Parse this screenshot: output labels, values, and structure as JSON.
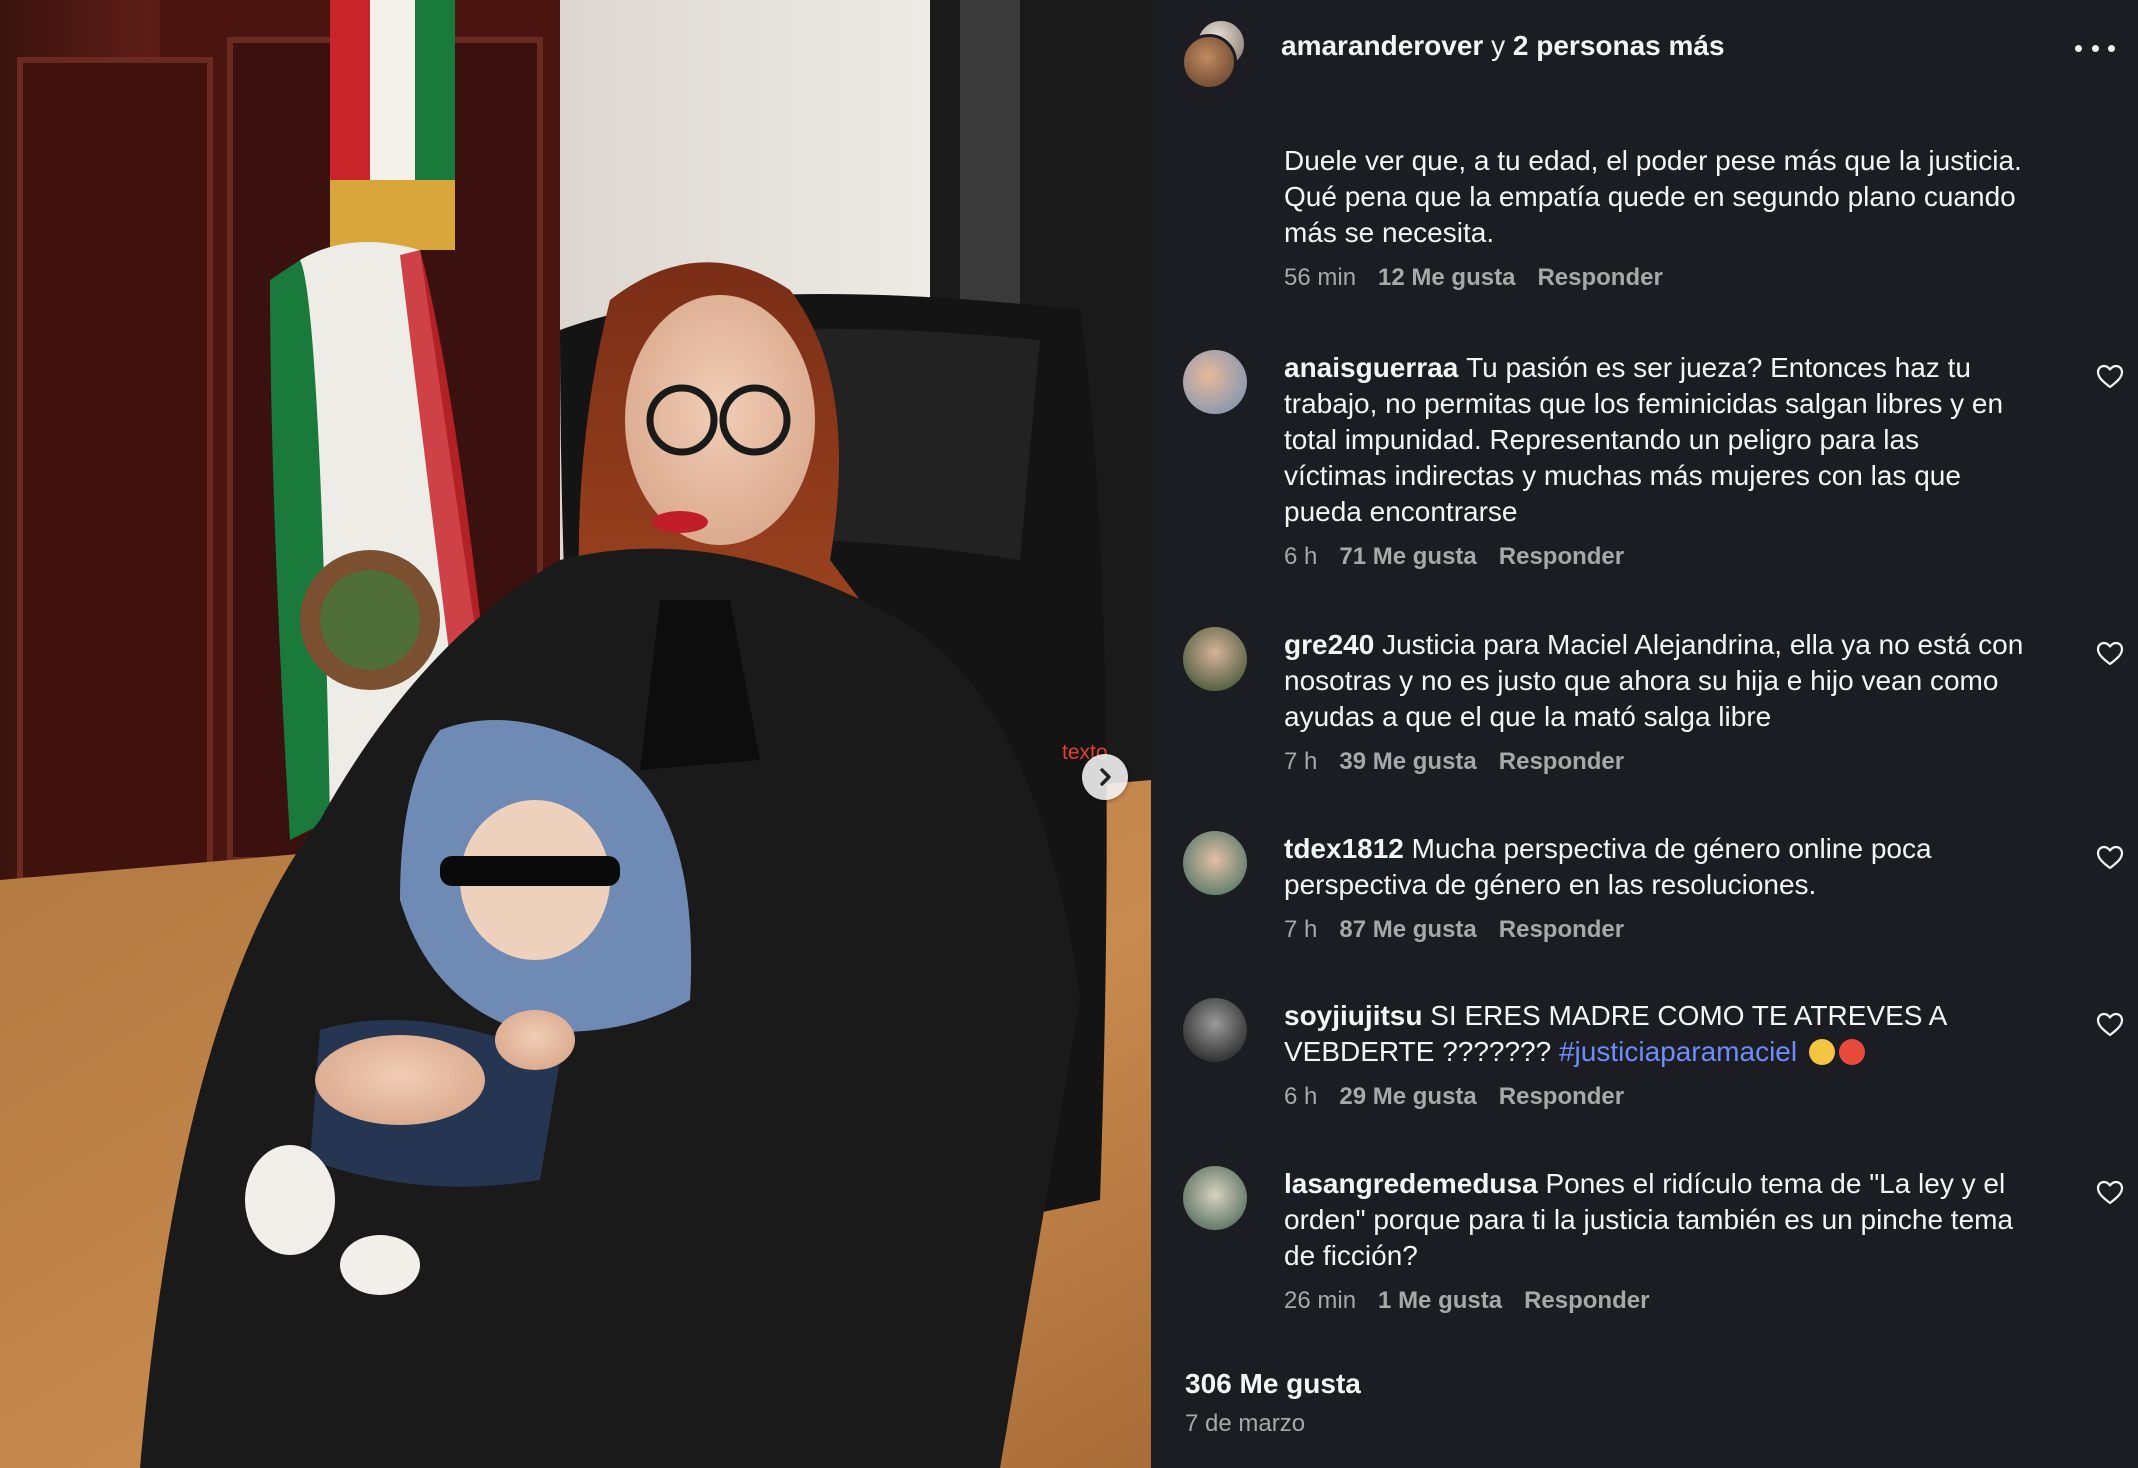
{
  "photo": {
    "caption_overlay": "texto",
    "next_icon": "chevron-right-icon"
  },
  "header": {
    "username": "amaranderover",
    "connector": "y",
    "others": "2 personas más",
    "more_icon": "more-horizontal-icon"
  },
  "comments": [
    {
      "username": "",
      "text": "Duele ver que, a tu edad, el poder pese más que la justicia. Qué pena que la empatía quede en segundo plano cuando más se necesita.",
      "time": "56 min",
      "likes": "12 Me gusta",
      "reply": "Responder"
    },
    {
      "username": "anaisguerraa",
      "text": "Tu pasión es ser jueza? Entonces haz tu trabajo, no permitas que los feminicidas salgan libres y en total impunidad. Representando un peligro para las víctimas indirectas y muchas más mujeres con las que pueda encontrarse",
      "time": "6 h",
      "likes": "71 Me gusta",
      "reply": "Responder"
    },
    {
      "username": "gre240",
      "text": "Justicia para Maciel Alejandrina, ella ya no está con nosotras y no es justo que ahora su hija e hijo vean como ayudas a que el que la mató salga libre",
      "time": "7 h",
      "likes": "39 Me gusta",
      "reply": "Responder"
    },
    {
      "username": "tdex1812",
      "text": "Mucha perspectiva de género online poca perspectiva de género en las resoluciones.",
      "time": "7 h",
      "likes": "87 Me gusta",
      "reply": "Responder"
    },
    {
      "username": "soyjiujitsu",
      "text": "SI ERES MADRE COMO TE ATREVES A VEBDERTE ???????",
      "hashtag": "#justiciaparamaciel",
      "time": "6 h",
      "likes": "29 Me gusta",
      "reply": "Responder"
    },
    {
      "username": "lasangredemedusa",
      "text": "Pones el ridículo tema de \"La ley y el orden\" porque para ti la justicia también es un pinche tema de ficción?",
      "time": "26 min",
      "likes": "1 Me gusta",
      "reply": "Responder"
    }
  ],
  "footer": {
    "likes_total": "306 Me gusta",
    "date": "7 de marzo"
  },
  "colors": {
    "panel_bg": "#1c1d22",
    "text": "#f5f5f5",
    "muted": "#a8a8a8",
    "hashtag": "#6c8dfa"
  }
}
